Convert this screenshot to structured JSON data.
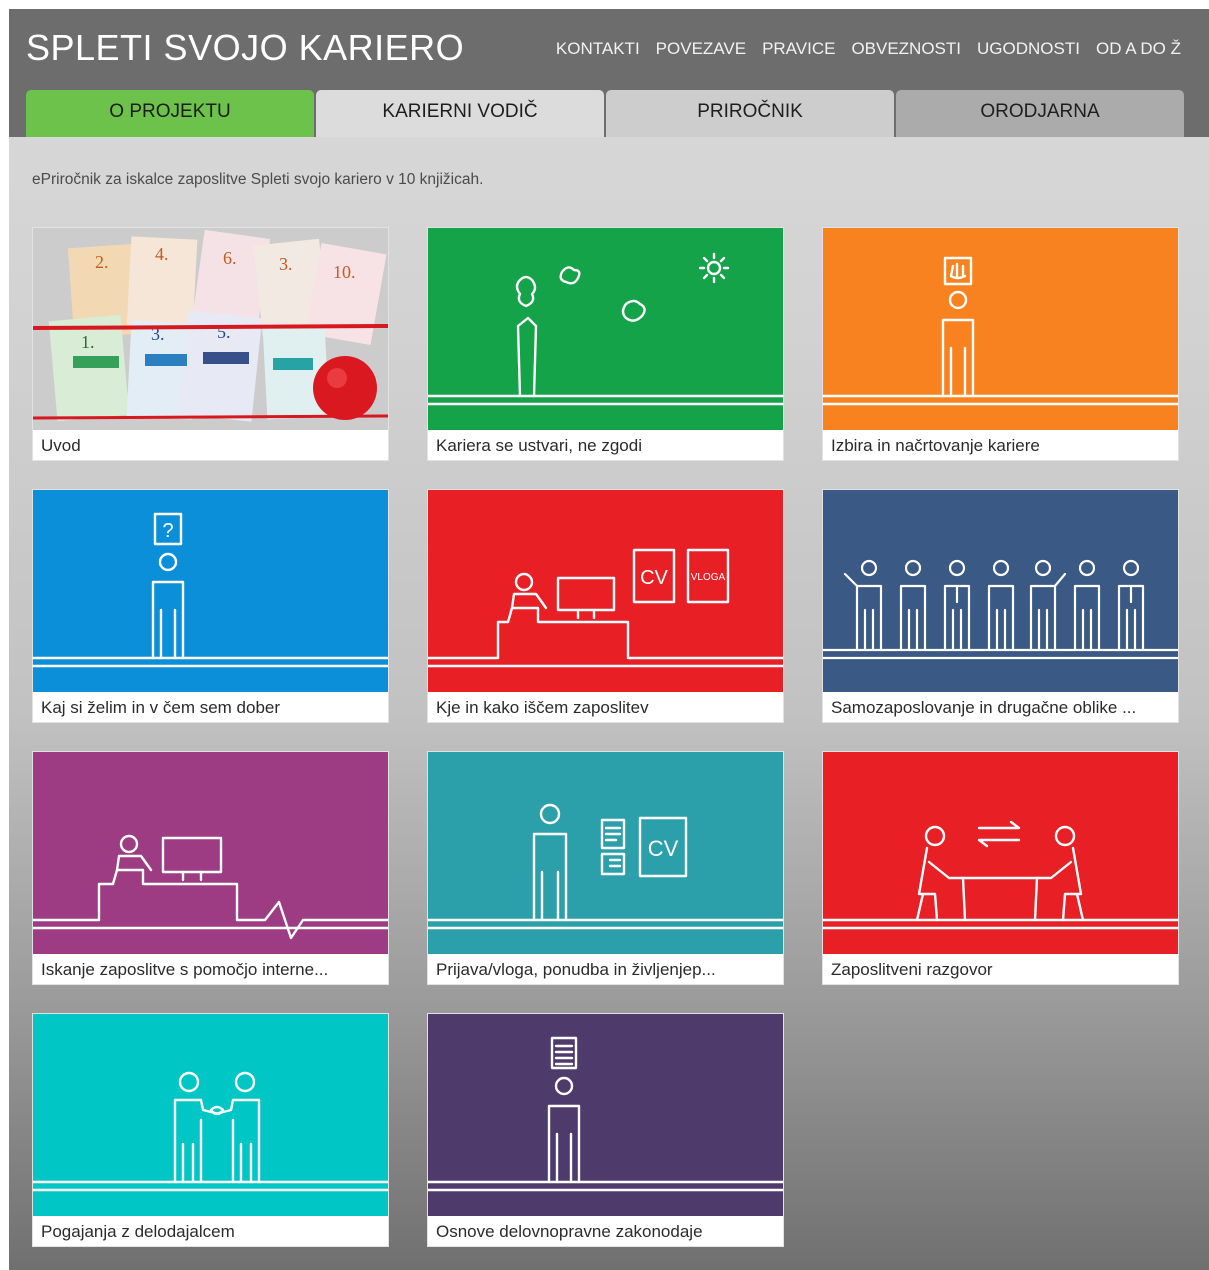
{
  "header": {
    "title": "SPLETI SVOJO KARIERO",
    "nav": [
      "KONTAKTI",
      "POVEZAVE",
      "PRAVICE",
      "OBVEZNOSTI",
      "UGODNOSTI",
      "OD A DO Ž"
    ]
  },
  "tabs": [
    {
      "label": "O PROJEKTU",
      "color": "#6cc24a"
    },
    {
      "label": "KARIERNI VODIČ",
      "color": "#dcdcdc"
    },
    {
      "label": "PRIROČNIK",
      "color": "#cdcdcd"
    },
    {
      "label": "ORODJARNA",
      "color": "#ababab"
    }
  ],
  "intro": "ePriročnik za iskalce zaposlitve Spleti svojo kariero v 10 knjižicah.",
  "cards": [
    {
      "label": "Uvod",
      "color": "#c9c9c9",
      "icon": "booklets-photo"
    },
    {
      "label": "Kariera se ustvari, ne zgodi",
      "color": "#15a34a",
      "icon": "person-clouds-sun"
    },
    {
      "label": "Izbira in načrtovanje kariere",
      "color": "#f7821f",
      "icon": "person-hand-sign"
    },
    {
      "label": "Kaj si želim in v čem sem dober",
      "color": "#0b8fd8",
      "icon": "person-question-mark"
    },
    {
      "label": "Kje in kako iščem zaposlitev",
      "color": "#e81f25",
      "icon": "person-computer-cv",
      "texts": [
        "CV",
        "VLOGA"
      ]
    },
    {
      "label": "Samozaposlovanje in drugačne oblike ...",
      "color": "#3a5a85",
      "icon": "group-of-people"
    },
    {
      "label": "Iskanje zaposlitve s pomočjo interne...",
      "color": "#9d3c82",
      "icon": "person-computer-signal"
    },
    {
      "label": "Prijava/vloga, ponudba in življenjep...",
      "color": "#2ba0aa",
      "icon": "person-documents-cv",
      "texts": [
        "CV"
      ]
    },
    {
      "label": "Zaposlitveni razgovor",
      "color": "#e81f25",
      "icon": "interview-table"
    },
    {
      "label": "Pogajanja z delodajalcem",
      "color": "#00c6c6",
      "icon": "handshake"
    },
    {
      "label": "Osnove delovnopravne zakonodaje",
      "color": "#4f3a6c",
      "icon": "person-document"
    }
  ]
}
